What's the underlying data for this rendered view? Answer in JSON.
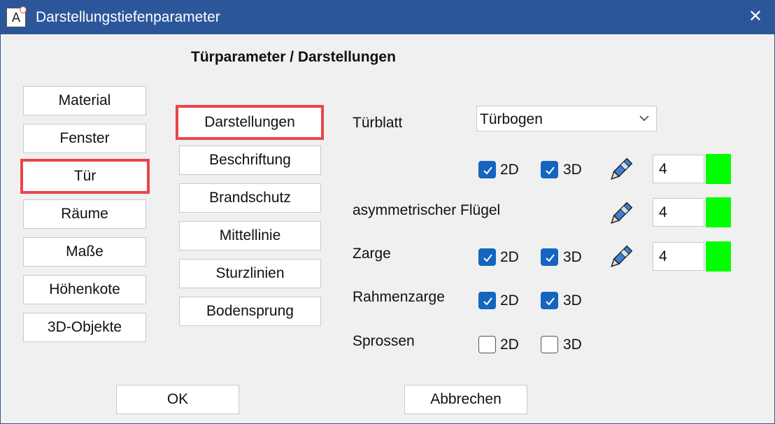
{
  "window": {
    "title": "Darstellungstiefenparameter",
    "app_icon_letter": "A",
    "close_glyph": "✕"
  },
  "heading": "Türparameter / Darstellungen",
  "categories": [
    {
      "label": "Material"
    },
    {
      "label": "Fenster"
    },
    {
      "label": "Tür",
      "selected": true
    },
    {
      "label": "Räume"
    },
    {
      "label": "Maße"
    },
    {
      "label": "Höhenkote"
    },
    {
      "label": "3D-Objekte"
    }
  ],
  "subcategories": [
    {
      "label": "Darstellungen",
      "selected": true
    },
    {
      "label": "Beschriftung"
    },
    {
      "label": "Brandschutz"
    },
    {
      "label": "Mittellinie"
    },
    {
      "label": "Sturzlinien"
    },
    {
      "label": "Bodensprung"
    }
  ],
  "rows": {
    "turblatt": {
      "label": "Türblatt",
      "dropdown_value": "Türbogen"
    },
    "turblatt_options": {
      "check_2d": true,
      "check_3d": true,
      "label_2d": "2D",
      "label_3d": "3D",
      "value": "4",
      "color": "#00ff00"
    },
    "asym": {
      "label": "asymmetrischer Flügel",
      "value": "4",
      "color": "#00ff00"
    },
    "zarge": {
      "label": "Zarge",
      "check_2d": true,
      "check_3d": true,
      "label_2d": "2D",
      "label_3d": "3D",
      "value": "4",
      "color": "#00ff00"
    },
    "rahmenzarge": {
      "label": "Rahmenzarge",
      "check_2d": true,
      "check_3d": true,
      "label_2d": "2D",
      "label_3d": "3D"
    },
    "sprossen": {
      "label": "Sprossen",
      "check_2d": false,
      "check_3d": false,
      "label_2d": "2D",
      "label_3d": "3D"
    }
  },
  "footer": {
    "ok_label": "OK",
    "cancel_label": "Abbrechen"
  },
  "icons": {
    "pencil": "pencil-icon",
    "checkmark": "checkmark-icon",
    "chevron": "chevron-down-icon"
  },
  "colors": {
    "titlebar": "#2b579a",
    "accent": "#1565c0",
    "highlight": "#e8464a",
    "swatch": "#00ff00"
  }
}
